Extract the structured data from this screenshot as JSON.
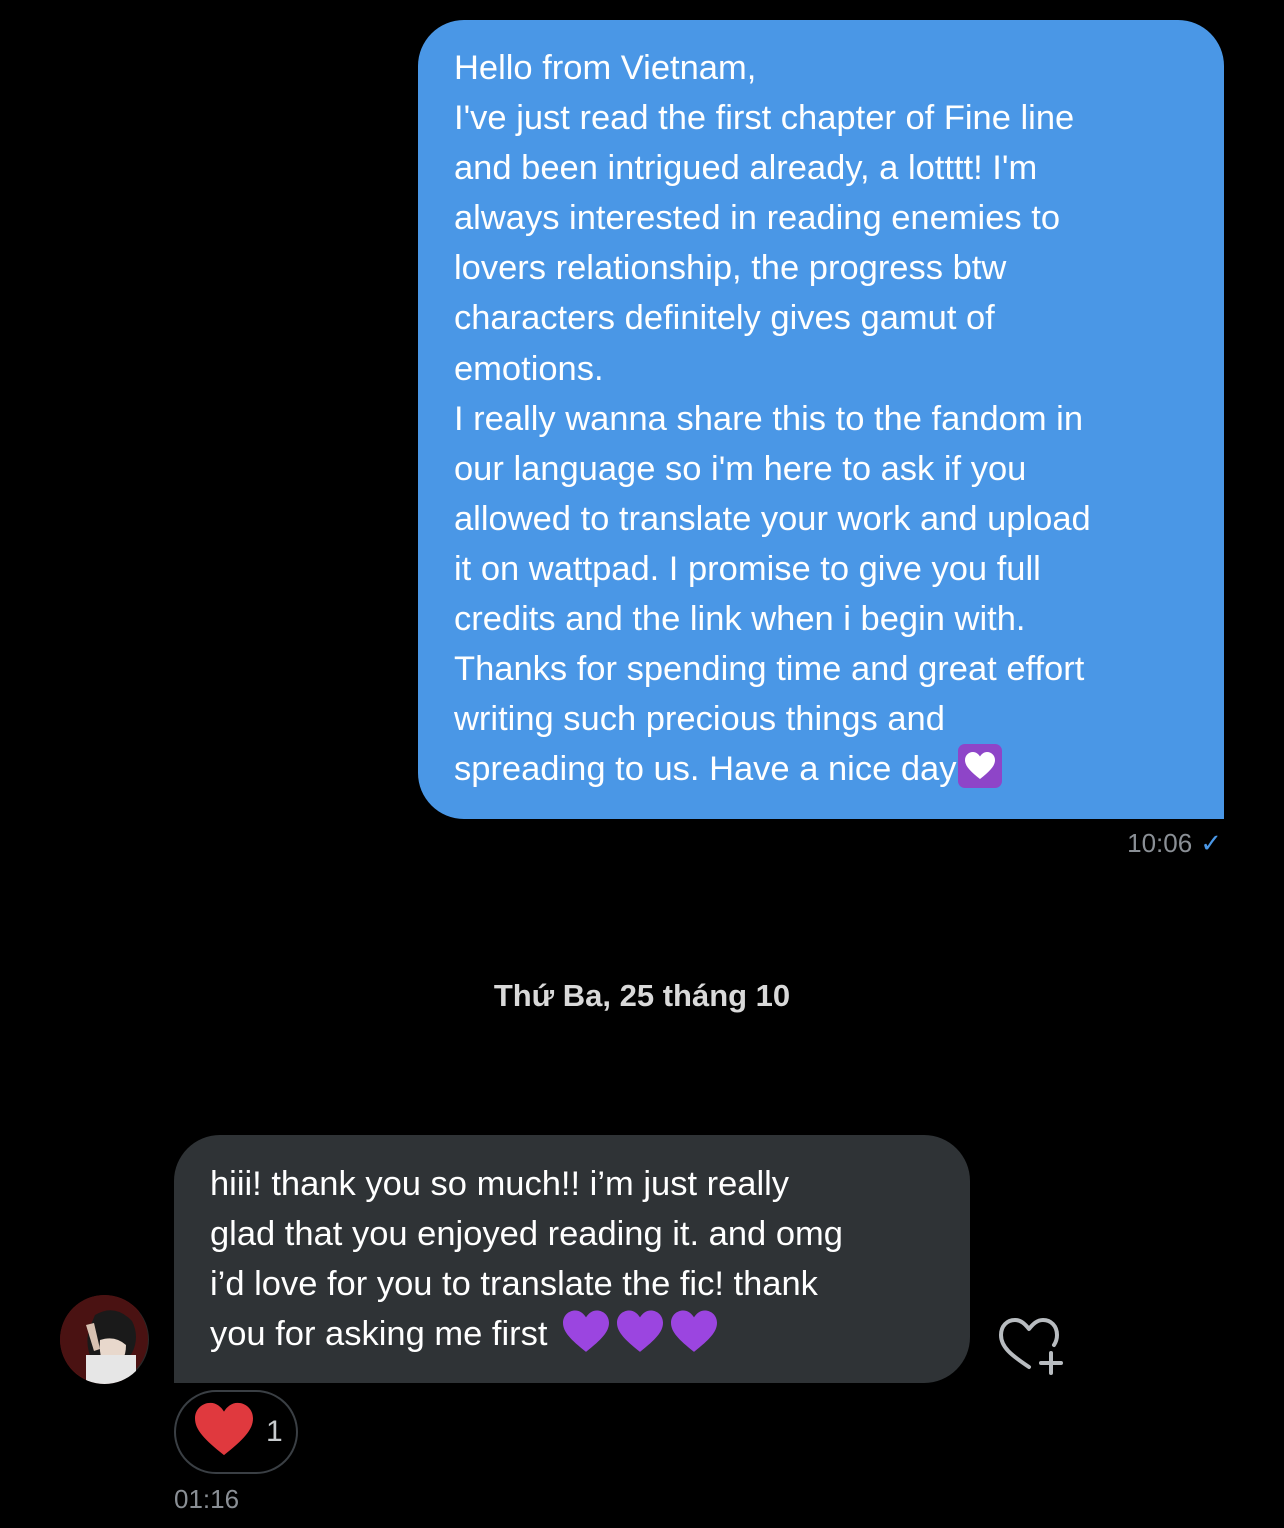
{
  "sent_message": {
    "lines": [
      "Hello from Vietnam,",
      "I've just read the first chapter of Fine line",
      "and been intrigued already, a lotttt! I'm",
      "always interested in reading enemies to",
      "lovers relationship, the progress btw",
      "characters definitely gives gamut of",
      "emotions.",
      "I really wanna share this to the fandom in",
      "our language so i'm here to ask if you",
      "allowed to translate your work and upload",
      "it on wattpad. I promise to give you full",
      "credits and the link when i begin with.",
      "Thanks for spending time and great effort",
      "writing such precious things and",
      "spreading to us. Have a nice day"
    ],
    "time": "10:06",
    "status_icon": "check-icon",
    "emoji": "white-heart-purple-box",
    "bubble_color": "#4a97e6"
  },
  "date_separator": "Thứ Ba, 25 tháng 10",
  "received_message": {
    "lines": [
      "hiii! thank you so much!! i’m just really",
      "glad that you enjoyed reading it. and omg",
      "i’d love for you to translate the fic! thank",
      "you for asking me first"
    ],
    "emojis": [
      "purple-heart",
      "purple-heart",
      "purple-heart"
    ],
    "time": "01:16",
    "bubble_color": "#2f3336",
    "reaction": {
      "icon": "red-heart",
      "count": "1"
    }
  }
}
